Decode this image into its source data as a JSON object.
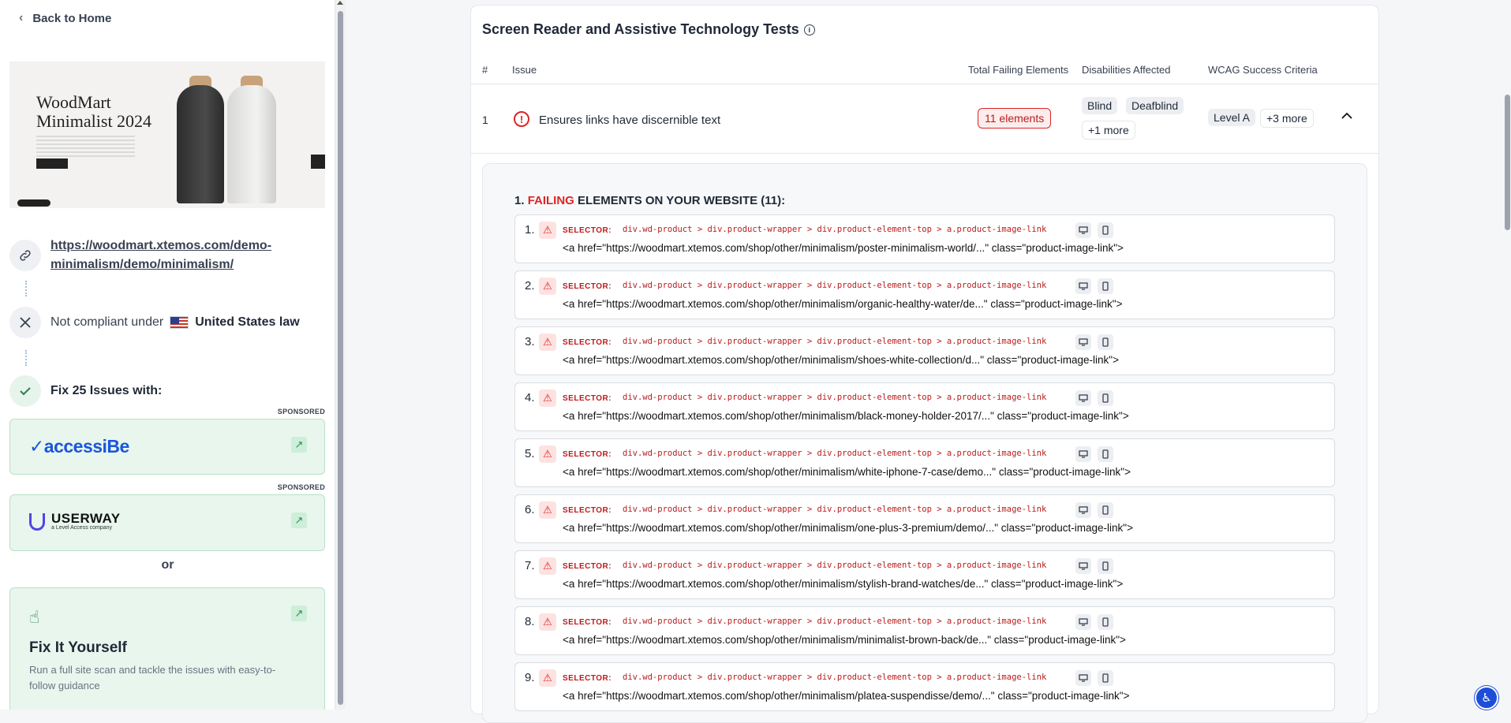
{
  "sidebar": {
    "back_label": "Back to Home",
    "thumbnail": {
      "title_line1": "WoodMart",
      "title_line2": "Minimalist 2024"
    },
    "url": "https://woodmart.xtemos.com/demo-minimalism/demo/minimalism/",
    "compliance": {
      "prefix": "Not compliant under",
      "country": "United States law"
    },
    "fix_label": "Fix 25 Issues with:",
    "sponsored_label": "SPONSORED",
    "vendors": [
      {
        "name": "accessiBe"
      },
      {
        "name": "USERWAY",
        "sub": "a Level Access company"
      }
    ],
    "or_label": "or",
    "fix_yourself": {
      "title": "Fix It Yourself",
      "desc": "Run a full site scan and tackle the issues with easy-to-follow guidance"
    }
  },
  "panel": {
    "title": "Screen Reader and Assistive Technology Tests",
    "columns": [
      "#",
      "Issue",
      "Total Failing Elements",
      "Disabilities Affected",
      "WCAG Success Criteria"
    ],
    "issue": {
      "num": "1",
      "text": "Ensures links have discernible text",
      "elements": "11 elements",
      "disabilities": [
        "Blind",
        "Deafblind",
        "+1 more"
      ],
      "wcag": [
        "Level A",
        "+3 more"
      ]
    },
    "failing": {
      "prefix": "1.",
      "highlight": "FAILING",
      "rest": "ELEMENTS ON YOUR WEBSITE (11):",
      "selector_label": "SELECTOR:",
      "selector": "div.wd-product > div.product-wrapper > div.product-element-top > a.product-image-link",
      "items": [
        {
          "n": "1.",
          "html": "<a href=\"https://woodmart.xtemos.com/shop/other/minimalism/poster-minimalism-world/...\" class=\"product-image-link\">"
        },
        {
          "n": "2.",
          "html": "<a href=\"https://woodmart.xtemos.com/shop/other/minimalism/organic-healthy-water/de...\" class=\"product-image-link\">"
        },
        {
          "n": "3.",
          "html": "<a href=\"https://woodmart.xtemos.com/shop/other/minimalism/shoes-white-collection/d...\" class=\"product-image-link\">"
        },
        {
          "n": "4.",
          "html": "<a href=\"https://woodmart.xtemos.com/shop/other/minimalism/black-money-holder-2017/...\" class=\"product-image-link\">"
        },
        {
          "n": "5.",
          "html": "<a href=\"https://woodmart.xtemos.com/shop/other/minimalism/white-iphone-7-case/demo...\" class=\"product-image-link\">"
        },
        {
          "n": "6.",
          "html": "<a href=\"https://woodmart.xtemos.com/shop/other/minimalism/one-plus-3-premium/demo/...\" class=\"product-image-link\">"
        },
        {
          "n": "7.",
          "html": "<a href=\"https://woodmart.xtemos.com/shop/other/minimalism/stylish-brand-watches/de...\" class=\"product-image-link\">"
        },
        {
          "n": "8.",
          "html": "<a href=\"https://woodmart.xtemos.com/shop/other/minimalism/minimalist-brown-back/de...\" class=\"product-image-link\">"
        },
        {
          "n": "9.",
          "html": "<a href=\"https://woodmart.xtemos.com/shop/other/minimalism/platea-suspendisse/demo/...\" class=\"product-image-link\">"
        }
      ]
    }
  },
  "colors": {
    "accent_red": "#dc2626",
    "accent_green": "#e8f6ee",
    "brand_blue": "#1a56db"
  }
}
